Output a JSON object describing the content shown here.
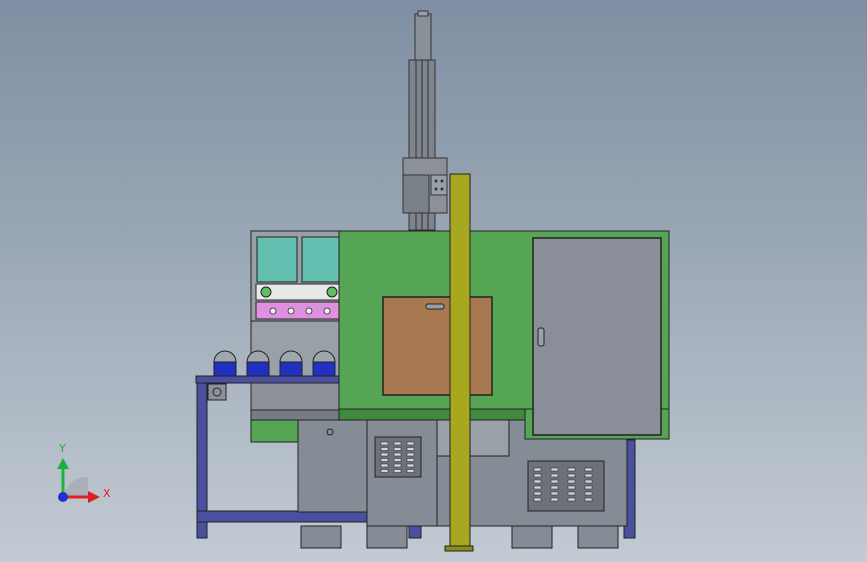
{
  "viewport": {
    "background_top": "#7f8fa3",
    "background_bottom": "#c3cbd4"
  },
  "triad": {
    "x_label": "X",
    "y_label": "Y",
    "x_color": "#e02020",
    "y_color": "#20b040",
    "z_color": "#2030d0"
  },
  "colors": {
    "frame_blue": "#4a4fa0",
    "enclosure_green": "#55a555",
    "steel_gray": "#868c96",
    "door_gray": "#8a8e98",
    "window_brown": "#a87850",
    "pillar_yellow": "#a8a820",
    "screen_teal": "#63c0b0",
    "control_pink": "#e090e0",
    "spool_blue": "#2030c0"
  }
}
